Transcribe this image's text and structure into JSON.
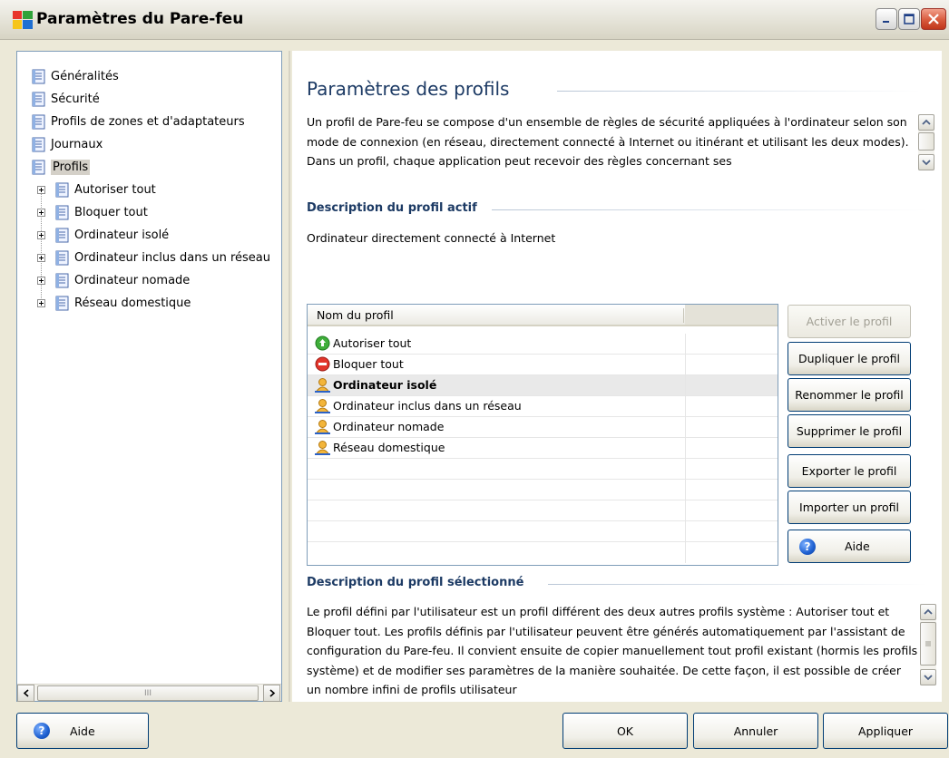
{
  "window": {
    "title": "Paramètres du Pare-feu"
  },
  "tree": {
    "items": [
      {
        "label": "Généralités"
      },
      {
        "label": "Sécurité"
      },
      {
        "label": "Profils de zones et d'adaptateurs"
      },
      {
        "label": "Journaux"
      },
      {
        "label": "Profils"
      }
    ],
    "children": [
      {
        "label": "Autoriser tout"
      },
      {
        "label": "Bloquer tout"
      },
      {
        "label": "Ordinateur isolé"
      },
      {
        "label": "Ordinateur inclus dans un réseau"
      },
      {
        "label": "Ordinateur nomade"
      },
      {
        "label": "Réseau domestique"
      }
    ],
    "scroll_thumb_glyph": "III"
  },
  "main": {
    "title": "Paramètres des profils",
    "intro": "Un profil de Pare-feu se compose d'un ensemble de règles de sécurité appliquées à l'ordinateur selon son mode de connexion (en réseau, directement connecté à Internet ou itinérant et utilisant les deux modes). Dans un profil, chaque application peut recevoir des règles concernant ses",
    "active_title": "Description du profil actif",
    "active_text": "Ordinateur directement connecté à Internet",
    "list_header": "Nom du profil",
    "profiles": [
      {
        "label": "Autoriser tout",
        "icon": "allow-icon"
      },
      {
        "label": "Bloquer tout",
        "icon": "block-icon"
      },
      {
        "label": "Ordinateur isolé",
        "icon": "user-icon",
        "selected": true
      },
      {
        "label": "Ordinateur inclus dans un réseau",
        "icon": "user-icon"
      },
      {
        "label": "Ordinateur nomade",
        "icon": "user-icon"
      },
      {
        "label": "Réseau domestique",
        "icon": "user-icon"
      }
    ],
    "buttons": {
      "activate": "Activer le profil",
      "duplicate": "Dupliquer le profil",
      "rename": "Renommer le profil",
      "delete": "Supprimer le profil",
      "export": "Exporter le profil",
      "import": "Importer un profil",
      "help": "Aide"
    },
    "selected_title": "Description du profil sélectionné",
    "selected_text": "Le profil défini par l'utilisateur est un profil différent des deux autres profils système : Autoriser tout et Bloquer tout. Les profils définis par l'utilisateur peuvent être générés automatiquement par l'assistant de configuration du Pare-feu. Il convient ensuite de copier manuellement tout profil existant (hormis les profils système) et de modifier ses paramètres de la manière souhaitée. De cette façon, il est possible de créer un nombre infini de profils utilisateur"
  },
  "footer": {
    "help": "Aide",
    "ok": "OK",
    "cancel": "Annuler",
    "apply": "Appliquer"
  },
  "colors": {
    "heading": "#1c3a64",
    "window_bg": "#ece9d8",
    "selection": "#e9e9e9"
  }
}
